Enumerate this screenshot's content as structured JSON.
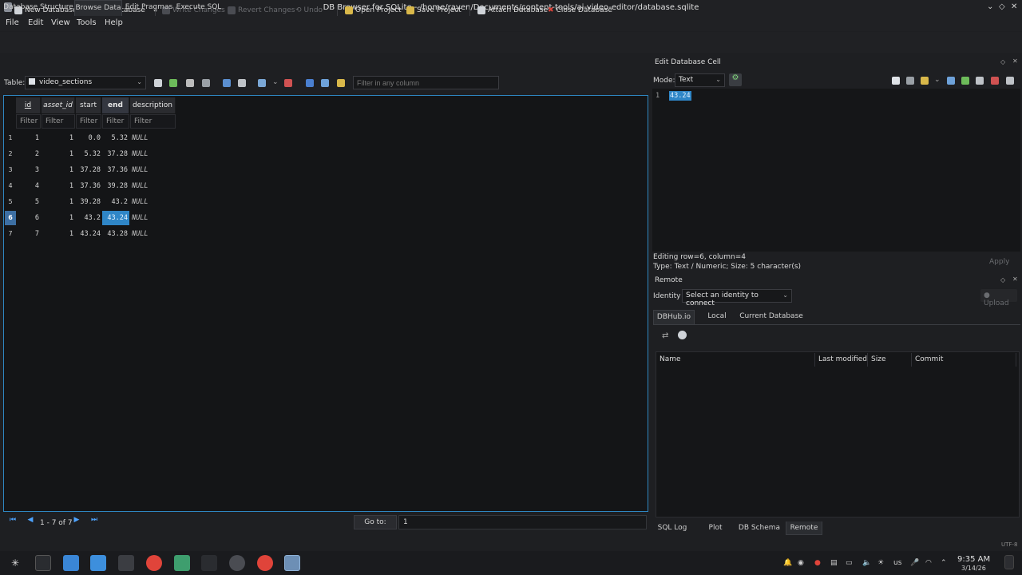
{
  "window": {
    "title": "DB Browser for SQLite - /home/rayen/Documents/content-tools/ai-video-editor/database.sqlite"
  },
  "menu": [
    "File",
    "Edit",
    "View",
    "Tools",
    "Help"
  ],
  "toolbar": {
    "new_db": "New Database",
    "open_db": "Open Database",
    "write": "Write Changes",
    "revert": "Revert Changes",
    "undo": "Undo",
    "open_project": "Open Project",
    "save_project": "Save Project",
    "attach": "Attach Database",
    "close": "Close Database"
  },
  "tabs": [
    "Database Structure",
    "Browse Data",
    "Edit Pragmas",
    "Execute SQL"
  ],
  "browse": {
    "table_label": "Table:",
    "table_value": "video_sections",
    "filter_placeholder": "Filter in any column"
  },
  "grid": {
    "columns": [
      "id",
      "asset_id",
      "start",
      "end",
      "description"
    ],
    "filter_text": "Filter",
    "rows": [
      {
        "n": "1",
        "id": "1",
        "asset_id": "1",
        "start": "0.0",
        "end": "5.32",
        "description": "NULL"
      },
      {
        "n": "2",
        "id": "2",
        "asset_id": "1",
        "start": "5.32",
        "end": "37.28",
        "description": "NULL"
      },
      {
        "n": "3",
        "id": "3",
        "asset_id": "1",
        "start": "37.28",
        "end": "37.36",
        "description": "NULL"
      },
      {
        "n": "4",
        "id": "4",
        "asset_id": "1",
        "start": "37.36",
        "end": "39.28",
        "description": "NULL"
      },
      {
        "n": "5",
        "id": "5",
        "asset_id": "1",
        "start": "39.28",
        "end": "43.2",
        "description": "NULL"
      },
      {
        "n": "6",
        "id": "6",
        "asset_id": "1",
        "start": "43.2",
        "end": "43.24",
        "description": "NULL"
      },
      {
        "n": "7",
        "id": "7",
        "asset_id": "1",
        "start": "43.24",
        "end": "43.28",
        "description": "NULL"
      }
    ],
    "selected_row": 6,
    "selected_column": "end"
  },
  "nav": {
    "range": "1 - 7 of 7",
    "goto_label": "Go to:",
    "goto_value": "1"
  },
  "edit_cell": {
    "title": "Edit Database Cell",
    "mode_label": "Mode:",
    "mode_value": "Text",
    "line_no": "1",
    "value": "43.24",
    "status1": "Editing row=6, column=4",
    "status2": "Type: Text / Numeric; Size: 5 character(s)",
    "apply": "Apply"
  },
  "remote": {
    "title": "Remote",
    "identity_label": "Identity",
    "identity_value": "Select an identity to connect",
    "upload": "Upload",
    "tabs": [
      "DBHub.io",
      "Local",
      "Current Database"
    ],
    "columns": [
      "Name",
      "Last modified",
      "Size",
      "Commit"
    ]
  },
  "bottom_tabs": [
    "SQL Log",
    "Plot",
    "DB Schema",
    "Remote"
  ],
  "status_encoding": "UTF-8",
  "taskbar": {
    "time": "9:35 AM",
    "date": "3/14/26",
    "kb_layout": "us"
  },
  "colors": {
    "accent": "#2f86c7",
    "background": "#1e1f22",
    "grid_bg": "#141517",
    "taskbar_red": "#e0443a"
  }
}
